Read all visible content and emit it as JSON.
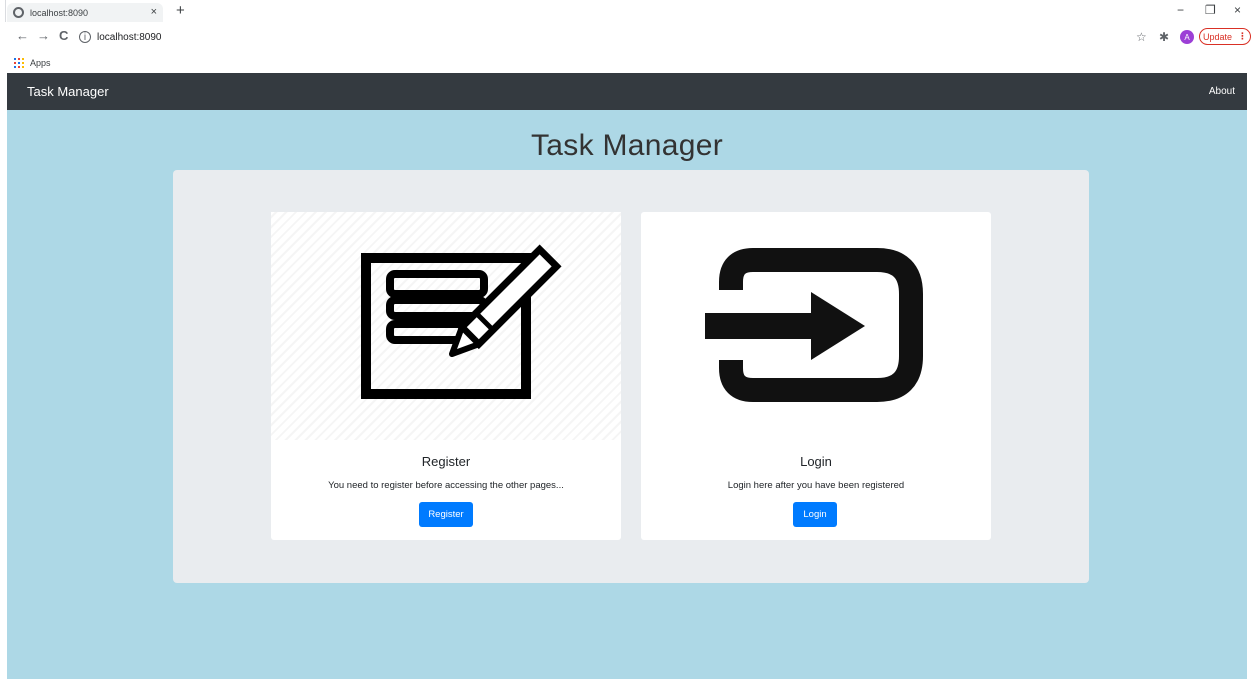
{
  "browser": {
    "tab_title": "localhost:8090",
    "tab_close": "×",
    "new_tab": "+",
    "url": "localhost:8090",
    "avatar_letter": "A",
    "update_label": "Update",
    "update_menu": "⋮",
    "bookmarks": {
      "apps_label": "Apps"
    },
    "win_minimize": "−",
    "win_restore": "❐",
    "win_close": "×",
    "back": "←",
    "forward": "→",
    "reload": "C",
    "star": "☆",
    "extensions": "✱"
  },
  "navbar": {
    "brand": "Task Manager",
    "about": "About"
  },
  "main": {
    "heading": "Task Manager",
    "cards": [
      {
        "title": "Register",
        "text": "You need to register before accessing the other pages...",
        "button": "Register",
        "icon": "register-form-pencil-icon"
      },
      {
        "title": "Login",
        "text": "Login here after you have been registered",
        "button": "Login",
        "icon": "login-arrow-icon"
      }
    ]
  },
  "colors": {
    "page_bg": "#add8e6",
    "navbar_bg": "#343a40",
    "jumbotron_bg": "#e9ecef",
    "primary": "#007bff"
  }
}
